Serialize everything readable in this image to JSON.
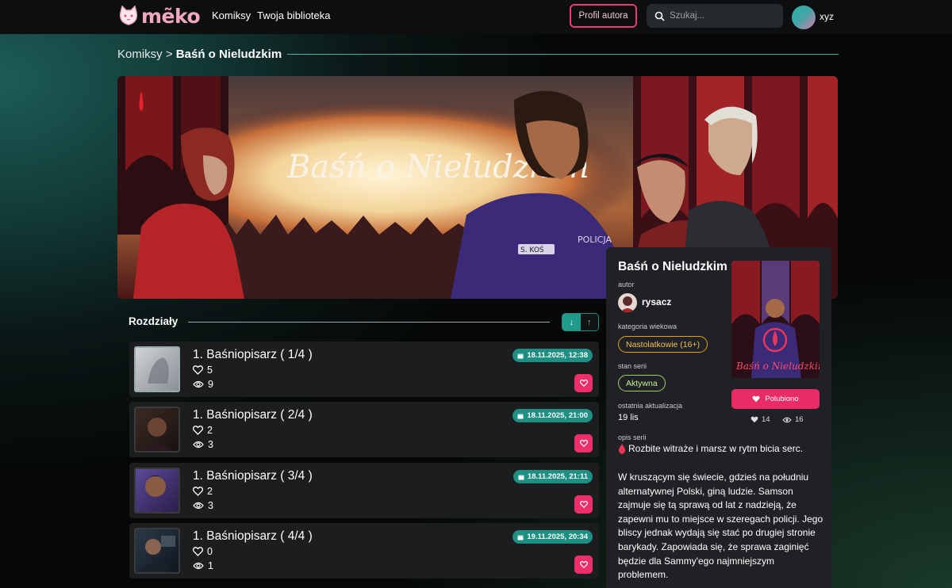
{
  "brand": {
    "name": "mẽko",
    "accent": "#f4a7c3"
  },
  "nav": {
    "comics": "Komiksy",
    "library": "Twoja biblioteka",
    "author_profile": "Profil autora",
    "search_placeholder": "Szukaj...",
    "username": "xyz"
  },
  "breadcrumb": {
    "parent": "Komiksy",
    "separator": ">",
    "current": "Baśń o Nieludzkim"
  },
  "banner": {
    "title_art": "Baśń o Nieludzkim",
    "badge": "S. KOŚ",
    "police": "POLICJA"
  },
  "chapters": {
    "header": "Rozdziały",
    "sort_down_icon": "arrow-down-icon",
    "sort_up_icon": "arrow-up-icon",
    "items": [
      {
        "title": "1. Baśniopisarz ( 1/4 )",
        "likes": "5",
        "views": "9",
        "date": "18.11.2025, 12:38"
      },
      {
        "title": "1. Baśniopisarz ( 2/4 )",
        "likes": "2",
        "views": "3",
        "date": "18.11.2025, 21:00"
      },
      {
        "title": "1. Baśniopisarz ( 3/4 )",
        "likes": "2",
        "views": "3",
        "date": "18.11.2025, 21:11"
      },
      {
        "title": "1. Baśniopisarz ( 4/4 )",
        "likes": "0",
        "views": "1",
        "date": "19.11.2025, 20:34"
      }
    ]
  },
  "panel": {
    "title": "Baśń o Nieludzkim",
    "author_label": "autor",
    "author": "rysacz",
    "age_label": "kategoria wiekowa",
    "age": "Nastolatkowie (16+)",
    "status_label": "stan serii",
    "status": "Aktywna",
    "updated_label": "ostatnia aktualizacja",
    "updated": "19 lis",
    "liked_button": "Polubiono",
    "likes": "14",
    "views": "16",
    "desc_label": "opis serii",
    "desc_head": "Rozbite witraże i marsz w rytm bicia serc.",
    "desc_body": "W kruszącym się świecie, gdzieś na południu alternatywnej Polski, giną ludzie. Samson zajmuje się tą sprawą od lat z nadzieją, że zapewni mu to miejsce w szeregach policji. Jego bliscy jednak wydają się stać po drugiej stronie barykady. Zapowiada się, że sprawa zaginięć będzie dla Sammy'ego najmniejszym problemem.",
    "cover_title": "Baśń o Nieludzkim"
  },
  "colors": {
    "teal": "#1f8f84",
    "pink": "#ea2c66",
    "amber": "#e4a21b",
    "green": "#9fd06a"
  }
}
